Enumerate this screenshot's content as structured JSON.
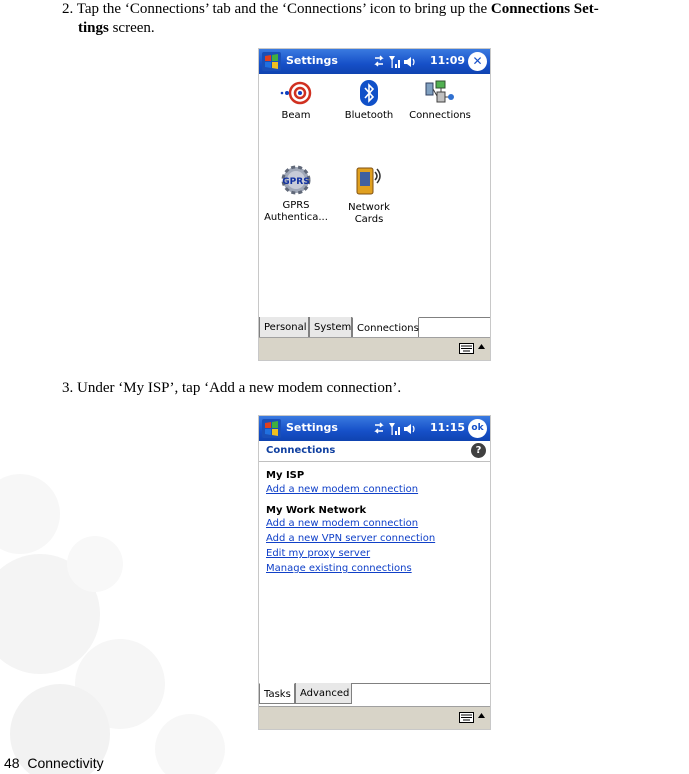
{
  "step2": {
    "prefix": "2. Tap the ‘Connections’ tab and the ‘Connections’ icon to bring up the ",
    "bold_a": "Connections Set-",
    "bold_b": "tings",
    "suffix": " screen."
  },
  "step3": {
    "text": "3. Under ‘My ISP’, tap ‘Add a new modem connection’."
  },
  "footer": {
    "page_number": "48",
    "section": "Connectivity"
  },
  "screen1": {
    "title": "Settings",
    "time": "11:09",
    "close_symbol": "✕",
    "icons": [
      {
        "label": "Beam"
      },
      {
        "label": "Bluetooth"
      },
      {
        "label": "Connections"
      },
      {
        "label": "GPRS Authentica..."
      },
      {
        "label": "Network Cards"
      }
    ],
    "gprs_badge": "GPRS",
    "tabs": [
      "Personal",
      "System",
      "Connections"
    ]
  },
  "screen2": {
    "title": "Settings",
    "time": "11:15",
    "ok_label": "ok",
    "header": "Connections",
    "help_symbol": "?",
    "section1": "My ISP",
    "section1_links": [
      "Add a new modem connection"
    ],
    "section2": "My Work Network",
    "section2_links": [
      "Add a new modem connection",
      "Add a new VPN server connection",
      "Edit my proxy server",
      "Manage existing connections"
    ],
    "tabs": [
      "Tasks",
      "Advanced"
    ]
  }
}
